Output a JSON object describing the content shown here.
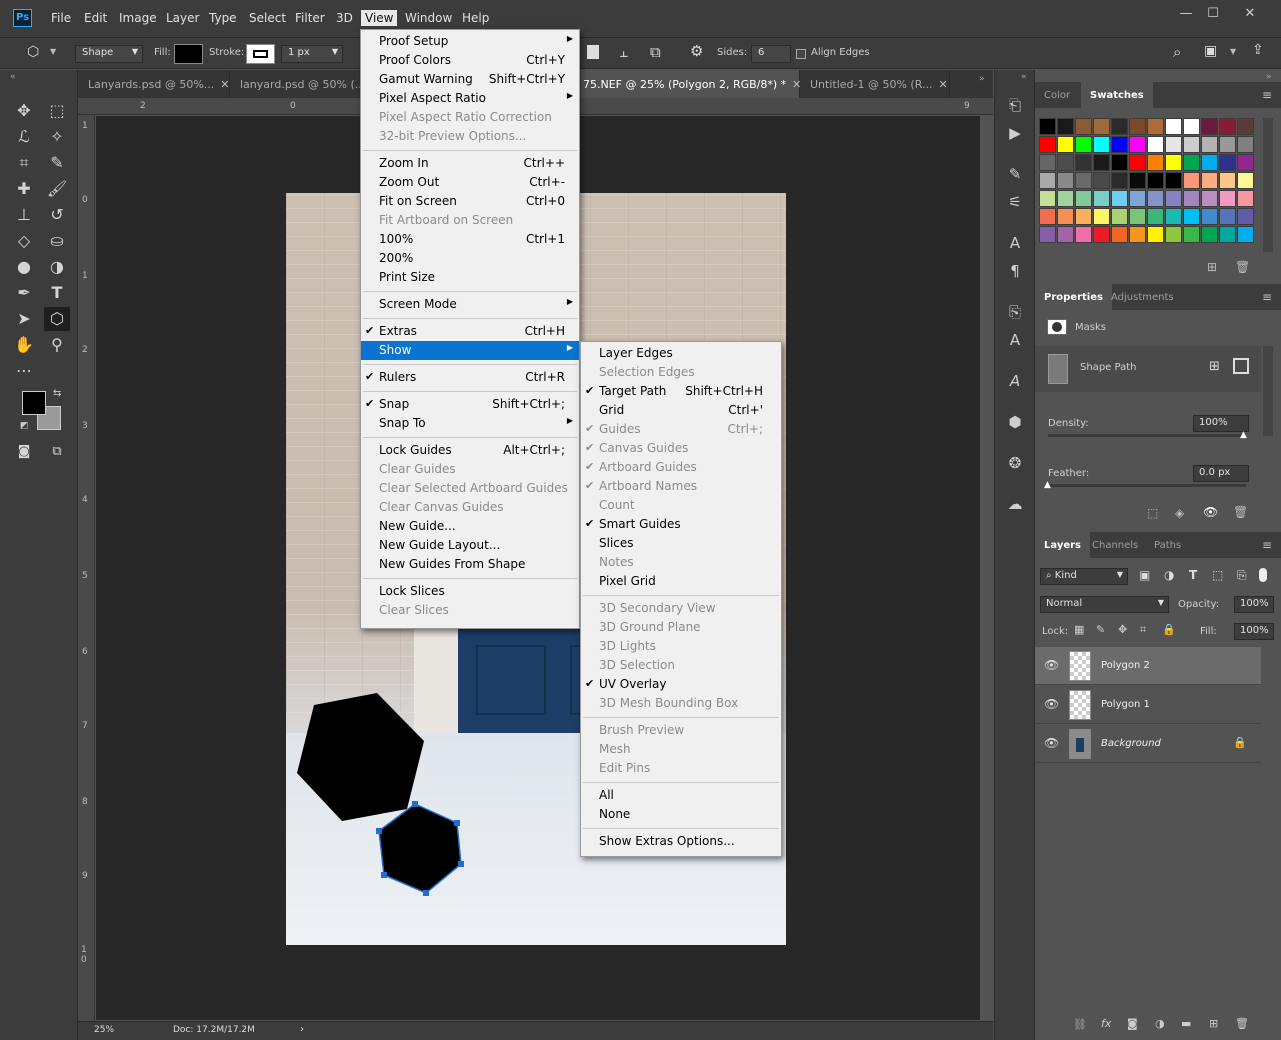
{
  "app": {
    "logo": "Ps"
  },
  "menubar": [
    "File",
    "Edit",
    "Image",
    "Layer",
    "Type",
    "Select",
    "Filter",
    "3D",
    "View",
    "Window",
    "Help"
  ],
  "window_controls": [
    "—",
    "☐",
    "✕"
  ],
  "options": {
    "mode": "Shape",
    "fill_label": "Fill:",
    "stroke_label": "Stroke:",
    "stroke_width": "1 px",
    "sides_label": "Sides:",
    "sides_value": "6",
    "align_edges": "Align Edges"
  },
  "tabs": [
    {
      "label": "Lanyards.psd @ 50%...",
      "close": "✕"
    },
    {
      "label": "lanyard.psd @ 50% (...",
      "close": "✕"
    },
    {
      "label": "75.NEF @ 25% (Polygon 2, RGB/8*) *",
      "close": "✕"
    },
    {
      "label": "Untitled-1 @ 50% (R...",
      "close": "✕"
    }
  ],
  "ruler_h": [
    "2",
    "0",
    "9"
  ],
  "ruler_v": [
    "1",
    "0",
    "1",
    "2",
    "3",
    "4",
    "5",
    "6",
    "7",
    "8",
    "9",
    "1 0"
  ],
  "status": {
    "zoom": "25%",
    "doc": "Doc: 17.2M/17.2M"
  },
  "view_menu": {
    "items": [
      {
        "label": "Proof Setup",
        "arrow": true
      },
      {
        "label": "Proof Colors",
        "shortcut": "Ctrl+Y"
      },
      {
        "label": "Gamut Warning",
        "shortcut": "Shift+Ctrl+Y"
      },
      {
        "label": "Pixel Aspect Ratio",
        "arrow": true
      },
      {
        "label": "Pixel Aspect Ratio Correction",
        "disabled": true
      },
      {
        "label": "32-bit Preview Options...",
        "disabled": true
      },
      {
        "sep": true
      },
      {
        "label": "Zoom In",
        "shortcut": "Ctrl++"
      },
      {
        "label": "Zoom Out",
        "shortcut": "Ctrl+-"
      },
      {
        "label": "Fit on Screen",
        "shortcut": "Ctrl+0"
      },
      {
        "label": "Fit Artboard on Screen",
        "disabled": true
      },
      {
        "label": "100%",
        "shortcut": "Ctrl+1"
      },
      {
        "label": "200%"
      },
      {
        "label": "Print Size"
      },
      {
        "sep": true
      },
      {
        "label": "Screen Mode",
        "arrow": true
      },
      {
        "sep": true
      },
      {
        "label": "Extras",
        "shortcut": "Ctrl+H",
        "checked": true
      },
      {
        "label": "Show",
        "arrow": true,
        "highlighted": true
      },
      {
        "sep": true
      },
      {
        "label": "Rulers",
        "shortcut": "Ctrl+R",
        "checked": true
      },
      {
        "sep": true
      },
      {
        "label": "Snap",
        "shortcut": "Shift+Ctrl+;",
        "checked": true
      },
      {
        "label": "Snap To",
        "arrow": true
      },
      {
        "sep": true
      },
      {
        "label": "Lock Guides",
        "shortcut": "Alt+Ctrl+;"
      },
      {
        "label": "Clear Guides",
        "disabled": true
      },
      {
        "label": "Clear Selected Artboard Guides",
        "disabled": true
      },
      {
        "label": "Clear Canvas Guides",
        "disabled": true
      },
      {
        "label": "New Guide..."
      },
      {
        "label": "New Guide Layout..."
      },
      {
        "label": "New Guides From Shape"
      },
      {
        "sep": true
      },
      {
        "label": "Lock Slices"
      },
      {
        "label": "Clear Slices",
        "disabled": true
      }
    ]
  },
  "show_menu": {
    "items": [
      {
        "label": "Layer Edges"
      },
      {
        "label": "Selection Edges",
        "disabled": true
      },
      {
        "label": "Target Path",
        "shortcut": "Shift+Ctrl+H",
        "checked": true
      },
      {
        "label": "Grid",
        "shortcut": "Ctrl+'"
      },
      {
        "label": "Guides",
        "shortcut": "Ctrl+;",
        "checked": true,
        "disabled": true
      },
      {
        "label": "Canvas Guides",
        "checked": true,
        "disabled": true
      },
      {
        "label": "Artboard Guides",
        "checked": true,
        "disabled": true
      },
      {
        "label": "Artboard Names",
        "checked": true,
        "disabled": true
      },
      {
        "label": "Count",
        "disabled": true
      },
      {
        "label": "Smart Guides",
        "checked": true
      },
      {
        "label": "Slices"
      },
      {
        "label": "Notes",
        "disabled": true
      },
      {
        "label": "Pixel Grid"
      },
      {
        "sep": true
      },
      {
        "label": "3D Secondary View",
        "disabled": true
      },
      {
        "label": "3D Ground Plane",
        "disabled": true
      },
      {
        "label": "3D Lights",
        "disabled": true
      },
      {
        "label": "3D Selection",
        "disabled": true
      },
      {
        "label": "UV Overlay",
        "checked": true
      },
      {
        "label": "3D Mesh Bounding Box",
        "disabled": true
      },
      {
        "sep": true
      },
      {
        "label": "Brush Preview",
        "disabled": true
      },
      {
        "label": "Mesh",
        "disabled": true
      },
      {
        "label": "Edit Pins",
        "disabled": true
      },
      {
        "sep": true
      },
      {
        "label": "All"
      },
      {
        "label": "None"
      },
      {
        "sep": true
      },
      {
        "label": "Show Extras Options..."
      }
    ]
  },
  "swatch_panel": {
    "tabs": [
      "Color",
      "Swatches"
    ],
    "rows": [
      [
        "#000000",
        "#1a1a1a",
        "#8b5a36",
        "#a06a3b",
        "#2a2a2a",
        "#7b4a2a",
        "#b26a3a",
        "#ffffff",
        "#ffffff",
        "#6b1a3a",
        "#8a1a3a",
        "#5a3a3a"
      ],
      [
        "#ff0000",
        "#ffff00",
        "#00ff00",
        "#00ffff",
        "#0000ff",
        "#ff00ff",
        "#ffffff",
        "#e6e6e6",
        "#cccccc",
        "#b3b3b3",
        "#999999",
        "#808080"
      ],
      [
        "#666666",
        "#4d4d4d",
        "#333333",
        "#1a1a1a",
        "#000000",
        "#ff0000",
        "#ff8000",
        "#ffff00",
        "#00a650",
        "#00aeef",
        "#2e3192",
        "#92278f"
      ],
      [
        "#aaaaaa",
        "#8a8a8a",
        "#6a6a6a",
        "#4a4a4a",
        "#2a2a2a",
        "#0a0a0a",
        "#000000",
        "#000000",
        "#f7977a",
        "#f9ad81",
        "#fdc68a",
        "#fff79a"
      ],
      [
        "#c4df9b",
        "#a3d39c",
        "#82ca9d",
        "#7bcdc8",
        "#6ecff6",
        "#7ea7d8",
        "#8493ca",
        "#8882be",
        "#a187be",
        "#bc8dbf",
        "#f49ac2",
        "#f6989d"
      ],
      [
        "#f26c4f",
        "#f68e55",
        "#fbaf5c",
        "#fff467",
        "#acd372",
        "#7cc576",
        "#3bb878",
        "#1abbb4",
        "#00bff3",
        "#438ccb",
        "#5574b9",
        "#605ca8"
      ],
      [
        "#855fa8",
        "#a763a8",
        "#f06eaa",
        "#ed1c24",
        "#f26522",
        "#f7941d",
        "#fff200",
        "#8dc63f",
        "#39b54a",
        "#00a651",
        "#00a99d",
        "#00aeef"
      ]
    ]
  },
  "properties": {
    "tabs": [
      "Properties",
      "Adjustments"
    ],
    "section": "Masks",
    "item": "Shape Path",
    "density_label": "Density:",
    "density": "100%",
    "feather_label": "Feather:",
    "feather": "0.0 px"
  },
  "layers_panel": {
    "tabs": [
      "Layers",
      "Channels",
      "Paths"
    ],
    "filter": "Kind",
    "blend": "Normal",
    "opacity_label": "Opacity:",
    "opacity": "100%",
    "lock_label": "Lock:",
    "fill_label": "Fill:",
    "fill": "100%",
    "layers": [
      {
        "name": "Polygon 2",
        "selected": true
      },
      {
        "name": "Polygon 1"
      },
      {
        "name": "Background",
        "locked": true
      }
    ]
  }
}
